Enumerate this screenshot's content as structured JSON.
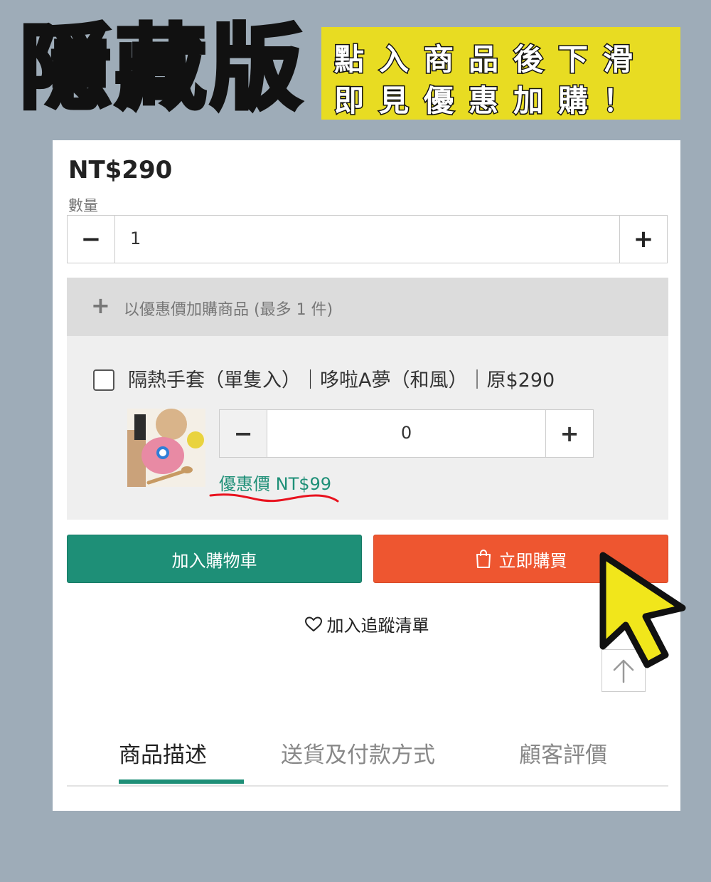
{
  "banner": {
    "title": "隱藏版",
    "line1": "點入商品後下滑",
    "line2": "即見優惠加購！"
  },
  "product": {
    "price": "NT$290",
    "quantity_label": "數量",
    "quantity_value": "1",
    "minus_symbol": "−",
    "plus_symbol": "+"
  },
  "addon": {
    "header_plus": "+",
    "header_text": "以優惠價加購商品 (最多 1 件)",
    "item_name": "隔熱手套（單隻入）｜哆啦A夢（和風）｜原$290",
    "item_quantity": "0",
    "item_price": "優惠價 NT$99",
    "underline_color": "#e8121e"
  },
  "actions": {
    "add_to_cart": "加入購物車",
    "buy_now": "立即購買",
    "wishlist": "加入追蹤清單"
  },
  "tabs": [
    {
      "label": "商品描述",
      "active": true
    },
    {
      "label": "送貨及付款方式",
      "active": false
    },
    {
      "label": "顧客評價",
      "active": false
    }
  ],
  "colors": {
    "background": "#9eacb8",
    "banner_yellow": "#e8dc22",
    "brand_green": "#1e8f77",
    "buy_orange": "#ee5630",
    "cursor_yellow": "#f1e61b"
  },
  "icons": {
    "buy": "shopping-bag-icon",
    "wishlist": "heart-icon",
    "scroll_top": "arrow-up-icon",
    "pointer": "mouse-pointer-icon"
  }
}
